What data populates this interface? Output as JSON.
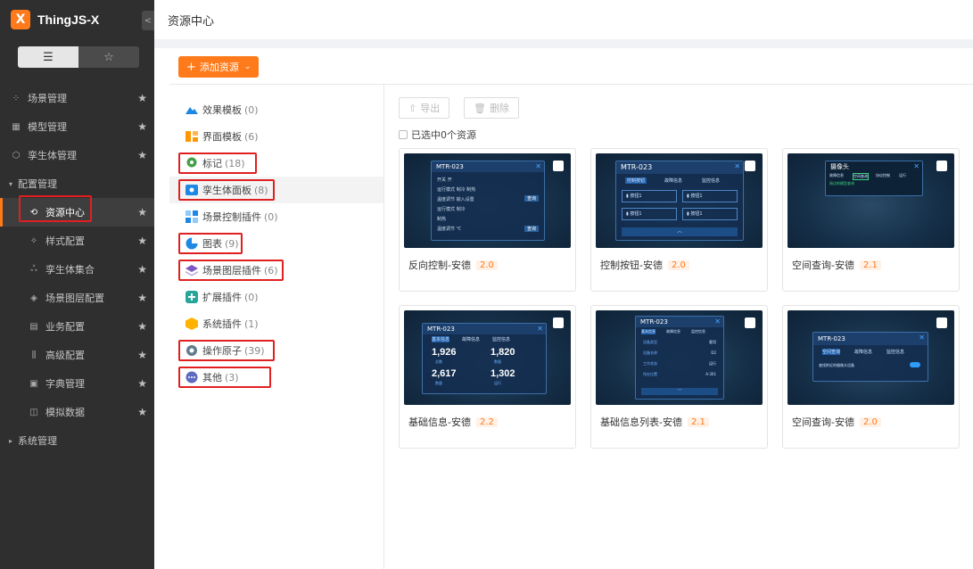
{
  "brand": {
    "name": "ThingJS-X",
    "logo_glyph": "X",
    "collapse_glyph": "<"
  },
  "view_toggle": {
    "list_icon": "list-icon",
    "star_icon": "star-icon"
  },
  "sidebar": {
    "items": [
      {
        "label": "场景管理",
        "icon": "grid-icon",
        "glyph": "⁘",
        "level": 1,
        "star": true
      },
      {
        "label": "模型管理",
        "icon": "model-icon",
        "glyph": "▦",
        "level": 1,
        "star": true
      },
      {
        "label": "孪生体管理",
        "icon": "cube-icon",
        "glyph": "⬡",
        "level": 1,
        "star": true
      },
      {
        "label": "配置管理",
        "icon": "caret-down-icon",
        "glyph": "▾",
        "level": 1,
        "star": false,
        "expanded": true
      },
      {
        "label": "资源中心",
        "icon": "resource-icon",
        "glyph": "⟲",
        "level": 2,
        "star": true,
        "active": true
      },
      {
        "label": "样式配置",
        "icon": "style-icon",
        "glyph": "✧",
        "level": 2,
        "star": true
      },
      {
        "label": "孪生体集合",
        "icon": "collection-icon",
        "glyph": "ஃ",
        "level": 2,
        "star": true
      },
      {
        "label": "场景图层配置",
        "icon": "layers-icon",
        "glyph": "◈",
        "level": 2,
        "star": true
      },
      {
        "label": "业务配置",
        "icon": "business-icon",
        "glyph": "▤",
        "level": 2,
        "star": true
      },
      {
        "label": "高级配置",
        "icon": "sliders-icon",
        "glyph": "⫼",
        "level": 2,
        "star": true
      },
      {
        "label": "字典管理",
        "icon": "dictionary-icon",
        "glyph": "▣",
        "level": 2,
        "star": true
      },
      {
        "label": "模拟数据",
        "icon": "mock-data-icon",
        "glyph": "◫",
        "level": 2,
        "star": true
      },
      {
        "label": "系统管理",
        "icon": "caret-right-icon",
        "glyph": "▸",
        "level": 1,
        "star": false
      }
    ]
  },
  "header": {
    "title": "资源中心"
  },
  "toolbar": {
    "add_label": "添加资源",
    "plus": "+",
    "dropdown": "⌄"
  },
  "categories": [
    {
      "label": "效果模板",
      "count": "(0)",
      "icon": "mountain-icon",
      "color": "#1e88e5"
    },
    {
      "label": "界面模板",
      "count": "(6)",
      "icon": "layout-icon",
      "color": "#ff9800"
    },
    {
      "label": "标记",
      "count": "(18)",
      "icon": "map-pin-icon",
      "color": "#43a047",
      "boxed": true
    },
    {
      "label": "孪生体面板",
      "count": "(8)",
      "icon": "panel-icon",
      "color": "#1e88e5",
      "boxed": true,
      "active": true
    },
    {
      "label": "场景控制插件",
      "count": "(0)",
      "icon": "plugin-blocks-icon",
      "color": "#1e88e5"
    },
    {
      "label": "图表",
      "count": "(9)",
      "icon": "pie-chart-icon",
      "color": "#1e88e5",
      "boxed": true
    },
    {
      "label": "场景图层插件",
      "count": "(6)",
      "icon": "layers-stack-icon",
      "color": "#7e57c2",
      "boxed": true
    },
    {
      "label": "扩展插件",
      "count": "(0)",
      "icon": "extend-plus-icon",
      "color": "#26a69a"
    },
    {
      "label": "系统插件",
      "count": "(1)",
      "icon": "system-box-icon",
      "color": "#ffb300"
    },
    {
      "label": "操作原子",
      "count": "(39)",
      "icon": "gear-atom-icon",
      "color": "#607d8b",
      "boxed": true
    },
    {
      "label": "其他",
      "count": "(3)",
      "icon": "more-dots-icon",
      "color": "#5c6bc0",
      "boxed": true
    }
  ],
  "content": {
    "export_label": "导出",
    "delete_label": "删除",
    "selection_text": "已选中0个资源",
    "cards": [
      {
        "title": "反向控制-安德",
        "version": "2.0",
        "panel_title": "MTR-023",
        "variant": "form",
        "form_rows": [
          {
            "label": "开关",
            "value": "开"
          },
          {
            "label": "运行模式",
            "value": "制冷  制热"
          },
          {
            "label": "温度调节",
            "value": "输入设置"
          },
          {
            "label": "运行模式",
            "value": "制冷"
          },
          {
            "label": "",
            "value": "制热"
          },
          {
            "label": "温度调节",
            "value": "℃"
          }
        ],
        "query": "查询"
      },
      {
        "title": "控制按钮-安德",
        "version": "2.0",
        "panel_title": "MTR-023",
        "variant": "buttons",
        "tabs": [
          "控制按钮",
          "故障信息",
          "监控信息"
        ],
        "btn_labels": [
          "按钮1",
          "按钮1",
          "按钮1",
          "按钮1"
        ]
      },
      {
        "title": "空间查询-安德",
        "version": "2.1",
        "panel_title": "摄像头",
        "variant": "dark",
        "tabs": [
          "故障信息",
          "空间查询",
          "协议控制",
          "运行"
        ],
        "note": "周边的模型查询"
      },
      {
        "title": "基础信息-安德",
        "version": "2.2",
        "panel_title": "MTR-023",
        "variant": "stats",
        "tabs": [
          "基本信息",
          "故障信息",
          "监控信息"
        ],
        "stats": [
          {
            "value": "1,926",
            "label": "总数"
          },
          {
            "value": "1,820",
            "label": "数量"
          },
          {
            "value": "2,617",
            "label": "数量"
          },
          {
            "value": "1,302",
            "label": "运行"
          }
        ]
      },
      {
        "title": "基础信息列表-安德",
        "version": "2.1",
        "panel_title": "MTR-023",
        "variant": "list",
        "tabs": [
          "基本信息",
          "故障信息",
          "监控信息"
        ],
        "rows": [
          {
            "k": "设备类型",
            "v": "客用"
          },
          {
            "k": "设备名称",
            "v": "D2"
          },
          {
            "k": "工作状态",
            "v": "运行"
          },
          {
            "k": "所在位置",
            "v": "A-301"
          }
        ]
      },
      {
        "title": "空间查询-安德",
        "version": "2.0",
        "panel_title": "MTR-023",
        "variant": "query",
        "tabs": [
          "空间查询",
          "故障信息",
          "监控信息"
        ],
        "note": "查找附近的摄像头设备"
      }
    ]
  }
}
